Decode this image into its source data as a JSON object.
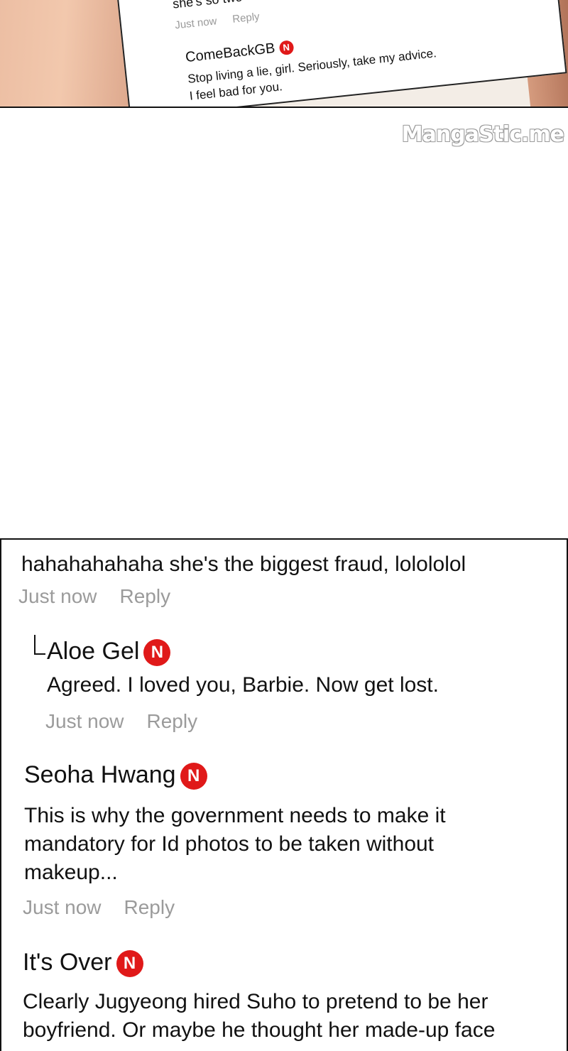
{
  "top_panel": {
    "snippet": "she's so two",
    "snippet_meta": {
      "time": "Just now",
      "reply": "Reply"
    },
    "comment": {
      "user": "ComeBackGB",
      "badge": "N",
      "line1": "Stop living a lie, girl. Seriously, take my advice.",
      "line2": "I feel bad for you."
    },
    "watermark": "MangaStic.me"
  },
  "comments": [
    {
      "text": "hahahahahaha she's the biggest fraud, lolololol",
      "time": "Just now",
      "reply": "Reply"
    },
    {
      "user": "Aloe Gel",
      "badge": "N",
      "text": "Agreed. I loved you, Barbie. Now get lost.",
      "time": "Just now",
      "reply": "Reply"
    },
    {
      "user": "Seoha Hwang",
      "badge": "N",
      "lines": [
        "This is why the government needs to make it",
        "mandatory for Id photos to be taken without",
        "makeup..."
      ],
      "time": "Just now",
      "reply": "Reply"
    },
    {
      "user": "It's Over",
      "badge": "N",
      "lines": [
        "Clearly Jugyeong hired Suho to pretend to be her",
        "boyfriend. Or maybe he thought her made-up face"
      ]
    }
  ],
  "colors": {
    "badge": "#e01919",
    "meta_text": "#9b9b9b",
    "border": "#111111"
  }
}
